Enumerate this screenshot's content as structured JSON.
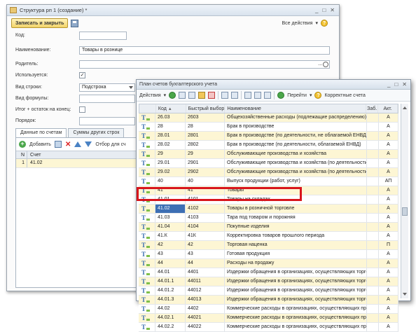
{
  "win1": {
    "title": "Структура рп 1 (создание) *",
    "save_close": "Записать и закрыть",
    "all_actions": "Все действия",
    "fields": {
      "kod_label": "Код:",
      "name_label": "Наименование:",
      "name_value": "Товары в рознице",
      "parent_label": "Родитель:",
      "used_label": "Используется:",
      "used_check": "✓",
      "row_kind_label": "Вид строки:",
      "row_kind_value": "Подстрока",
      "formula_label": "Вид формулы:",
      "total_label": "Итог + остаток на конец:",
      "order_label": "Порядок:"
    },
    "tabs": [
      "Данные по счетам",
      "Суммы других строк"
    ],
    "panel": {
      "add": "Добавить",
      "filter": "Отбор для сч",
      "col_n": "N",
      "col_account": "Счет",
      "row_n": "1",
      "row_account": "41.02",
      "row_dots": "..."
    }
  },
  "win2": {
    "title": "План счетов бухгалтерского учета",
    "actions": "Действия",
    "goto": "Перейти",
    "correct": "Корректные счета",
    "columns": {
      "code": "Код",
      "fast": "Быстрый выбор",
      "name": "Наименование",
      "zab": "Заб.",
      "act": "Акт."
    },
    "rows": [
      {
        "code": "26.03",
        "fast": "2603",
        "name": "Общехозяйственные расходы (подлежащие распределению)",
        "act": "А"
      },
      {
        "code": "28",
        "fast": "28",
        "name": "Брак в производстве",
        "act": "А"
      },
      {
        "code": "28.01",
        "fast": "2801",
        "name": "Брак в производстве (по деятельности, не облагаемой ЕНВД)",
        "act": "А"
      },
      {
        "code": "28.02",
        "fast": "2802",
        "name": "Брак в производстве (по деятельности, облагаемой ЕНВД)",
        "act": "А"
      },
      {
        "code": "29",
        "fast": "29",
        "name": "Обслуживающие производства и хозяйства",
        "act": "А"
      },
      {
        "code": "29.01",
        "fast": "2901",
        "name": "Обслуживающие производства и хозяйства (по деятельности, не ...",
        "act": "А"
      },
      {
        "code": "29.02",
        "fast": "2902",
        "name": "Обслуживающие производства и хозяйства (по деятельности, обл...",
        "act": "А"
      },
      {
        "code": "40",
        "fast": "40",
        "name": "Выпуск продукции (работ, услуг)",
        "act": "АП"
      },
      {
        "code": "41",
        "fast": "41",
        "name": "Товары",
        "act": "А"
      },
      {
        "code": "41.01",
        "fast": "4101",
        "name": "Товары на складах",
        "act": "А"
      },
      {
        "code": "41.02",
        "fast": "4102",
        "name": "Товары в розничной торговле",
        "act": "А",
        "selected": true
      },
      {
        "code": "41.03",
        "fast": "4103",
        "name": "Тара под товаром и порожняя",
        "act": "А"
      },
      {
        "code": "41.04",
        "fast": "4104",
        "name": "Покупные изделия",
        "act": "А"
      },
      {
        "code": "41.К",
        "fast": "41К",
        "name": "Корректировка товаров прошлого периода",
        "act": "А"
      },
      {
        "code": "42",
        "fast": "42",
        "name": "Торговая наценка",
        "act": "П"
      },
      {
        "code": "43",
        "fast": "43",
        "name": "Готовая продукция",
        "act": "А"
      },
      {
        "code": "44",
        "fast": "44",
        "name": "Расходы на продажу",
        "act": "А"
      },
      {
        "code": "44.01",
        "fast": "4401",
        "name": "Издержки обращения в организациях, осуществляющих торговую...",
        "act": "А"
      },
      {
        "code": "44.01.1",
        "fast": "44011",
        "name": "Издержки обращения в организациях, осуществляющих торговую...",
        "act": "А"
      },
      {
        "code": "44.01.2",
        "fast": "44012",
        "name": "Издержки обращения в организациях, осуществляющих торговую...",
        "act": "А"
      },
      {
        "code": "44.01.3",
        "fast": "44013",
        "name": "Издержки обращения в организациях, осуществляющих торговую...",
        "act": "А"
      },
      {
        "code": "44.02",
        "fast": "4402",
        "name": "Коммерческие расходы в организациях, осуществляющих промы...",
        "act": "А"
      },
      {
        "code": "44.02.1",
        "fast": "44021",
        "name": "Коммерческие расходы в организациях, осуществляющих промы...",
        "act": "А"
      },
      {
        "code": "44.02.2",
        "fast": "44022",
        "name": "Коммерческие расходы в организациях, осуществляющих промы...",
        "act": "А"
      }
    ]
  },
  "colors": {
    "highlight": "#d8141c",
    "row_yellow": "#fdf6d4",
    "selection": "#3d6fb4"
  }
}
